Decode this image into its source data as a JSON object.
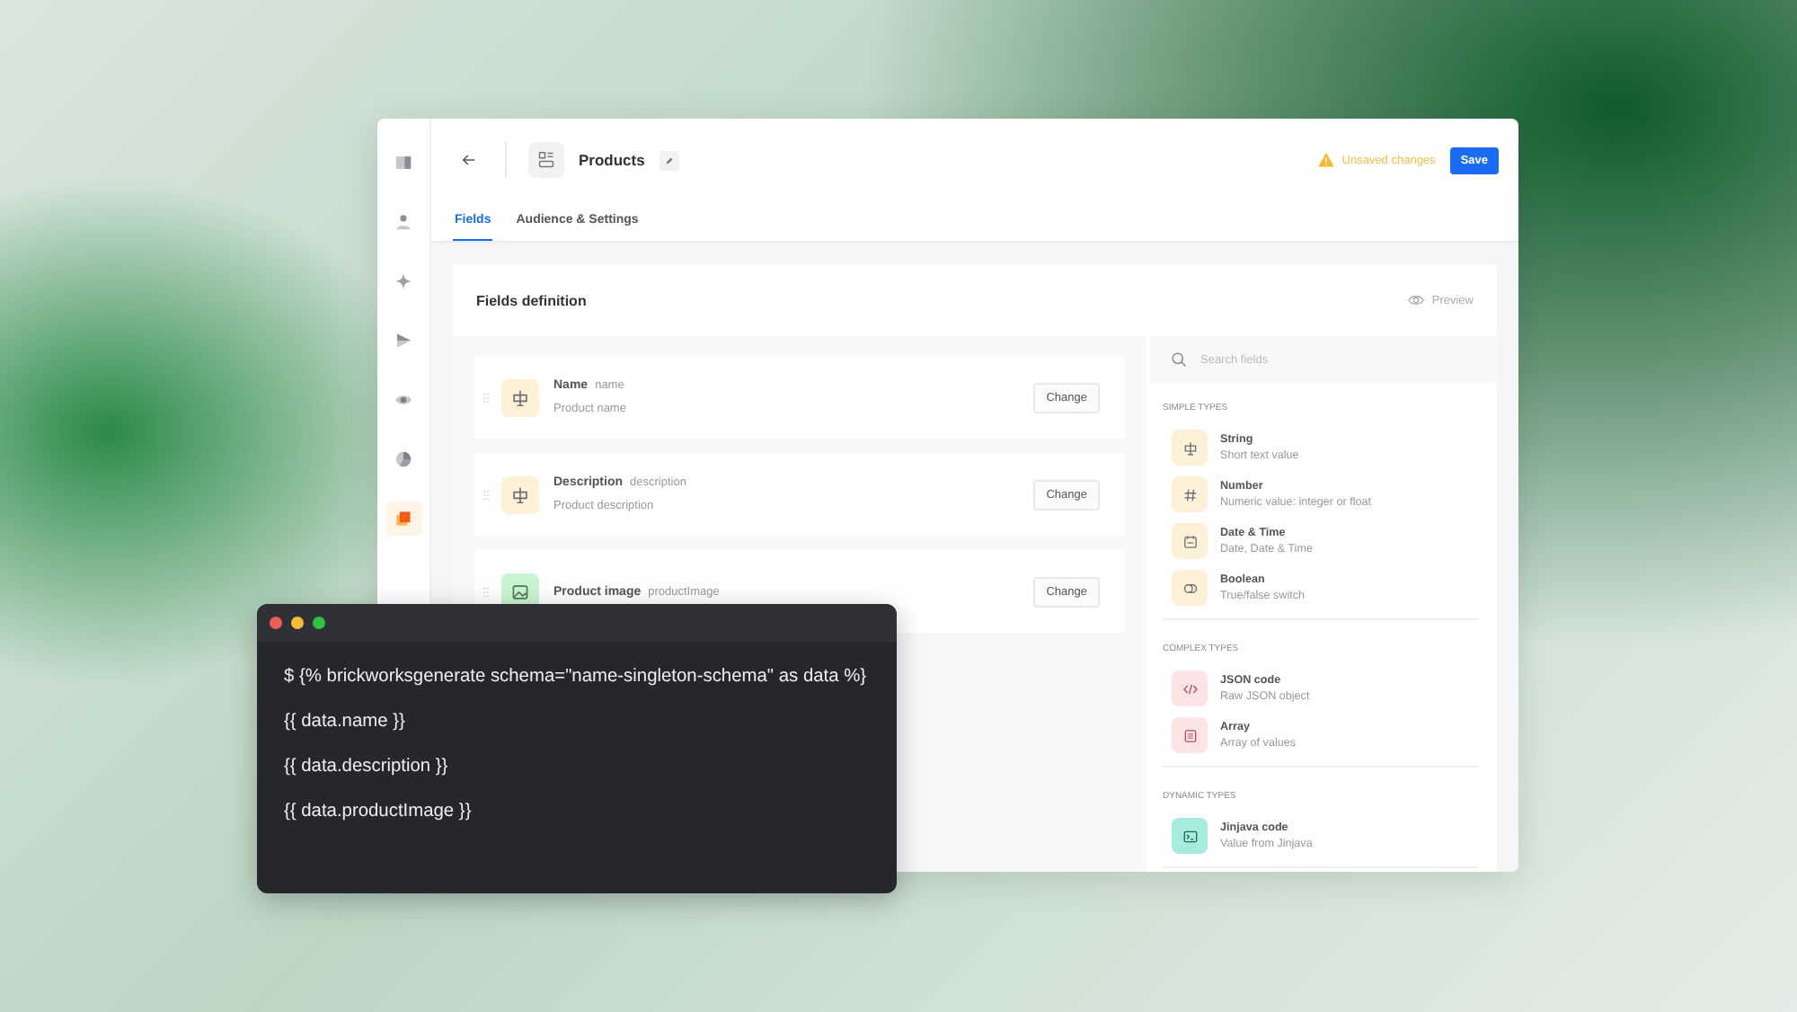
{
  "sidebar": {
    "items": [
      {
        "kind": "layout",
        "selected": false
      },
      {
        "kind": "person",
        "selected": false
      },
      {
        "kind": "sparkle",
        "selected": false
      },
      {
        "kind": "send",
        "selected": false
      },
      {
        "kind": "eye",
        "selected": false
      },
      {
        "kind": "pie",
        "selected": false
      },
      {
        "kind": "blocks",
        "selected": true
      }
    ]
  },
  "header": {
    "title": "Products",
    "warning": "Unsaved changes",
    "save": "Save"
  },
  "tabs": [
    {
      "label": "Fields",
      "selected": true
    },
    {
      "label": "Audience & Settings",
      "selected": false
    }
  ],
  "card": {
    "title": "Fields definition",
    "preview": "Preview",
    "fields": [
      {
        "kind": "text",
        "color": "#fdf1d8",
        "label": "Name",
        "key": "name",
        "description": "Product name",
        "button": "Change"
      },
      {
        "kind": "text",
        "color": "#fdf1d8",
        "label": "Description",
        "key": "description",
        "description": "Product description",
        "button": "Change"
      },
      {
        "kind": "image",
        "color": "#c8f5cf",
        "label": "Product image",
        "key": "productImage",
        "button": "Change"
      }
    ],
    "types": {
      "search": {
        "placeholder": "Search fields"
      },
      "groups": [
        {
          "title": "SIMPLE TYPES",
          "items": [
            {
              "kind": "text",
              "color": "#fdf1d8",
              "name": "String",
              "description": "Short text value"
            },
            {
              "kind": "hash",
              "color": "#fdf1d8",
              "name": "Number",
              "description": "Numeric value: integer or float"
            },
            {
              "kind": "calendar",
              "color": "#fdf1d8",
              "name": "Date & Time",
              "description": "Date, Date & Time"
            },
            {
              "kind": "toggle",
              "color": "#fdf1d8",
              "name": "Boolean",
              "description": "True/false switch"
            }
          ]
        },
        {
          "title": "COMPLEX TYPES",
          "items": [
            {
              "kind": "code",
              "color": "#fbe3e6",
              "name": "JSON code",
              "description": "Raw JSON object"
            },
            {
              "kind": "list",
              "color": "#fbe3e6",
              "name": "Array",
              "description": "Array of values"
            }
          ]
        },
        {
          "title": "DYNAMIC TYPES",
          "items": [
            {
              "kind": "terminal",
              "color": "#a5ecdf",
              "name": "Jinjava code",
              "description": "Value from Jinjava"
            }
          ]
        }
      ]
    }
  },
  "terminal": {
    "lines": [
      "$ {% brickworksgenerate schema=\"name-singleton-schema\" as data %}",
      "{{ data.name }}",
      "{{ data.description }}",
      "{{ data.productImage }}"
    ]
  }
}
